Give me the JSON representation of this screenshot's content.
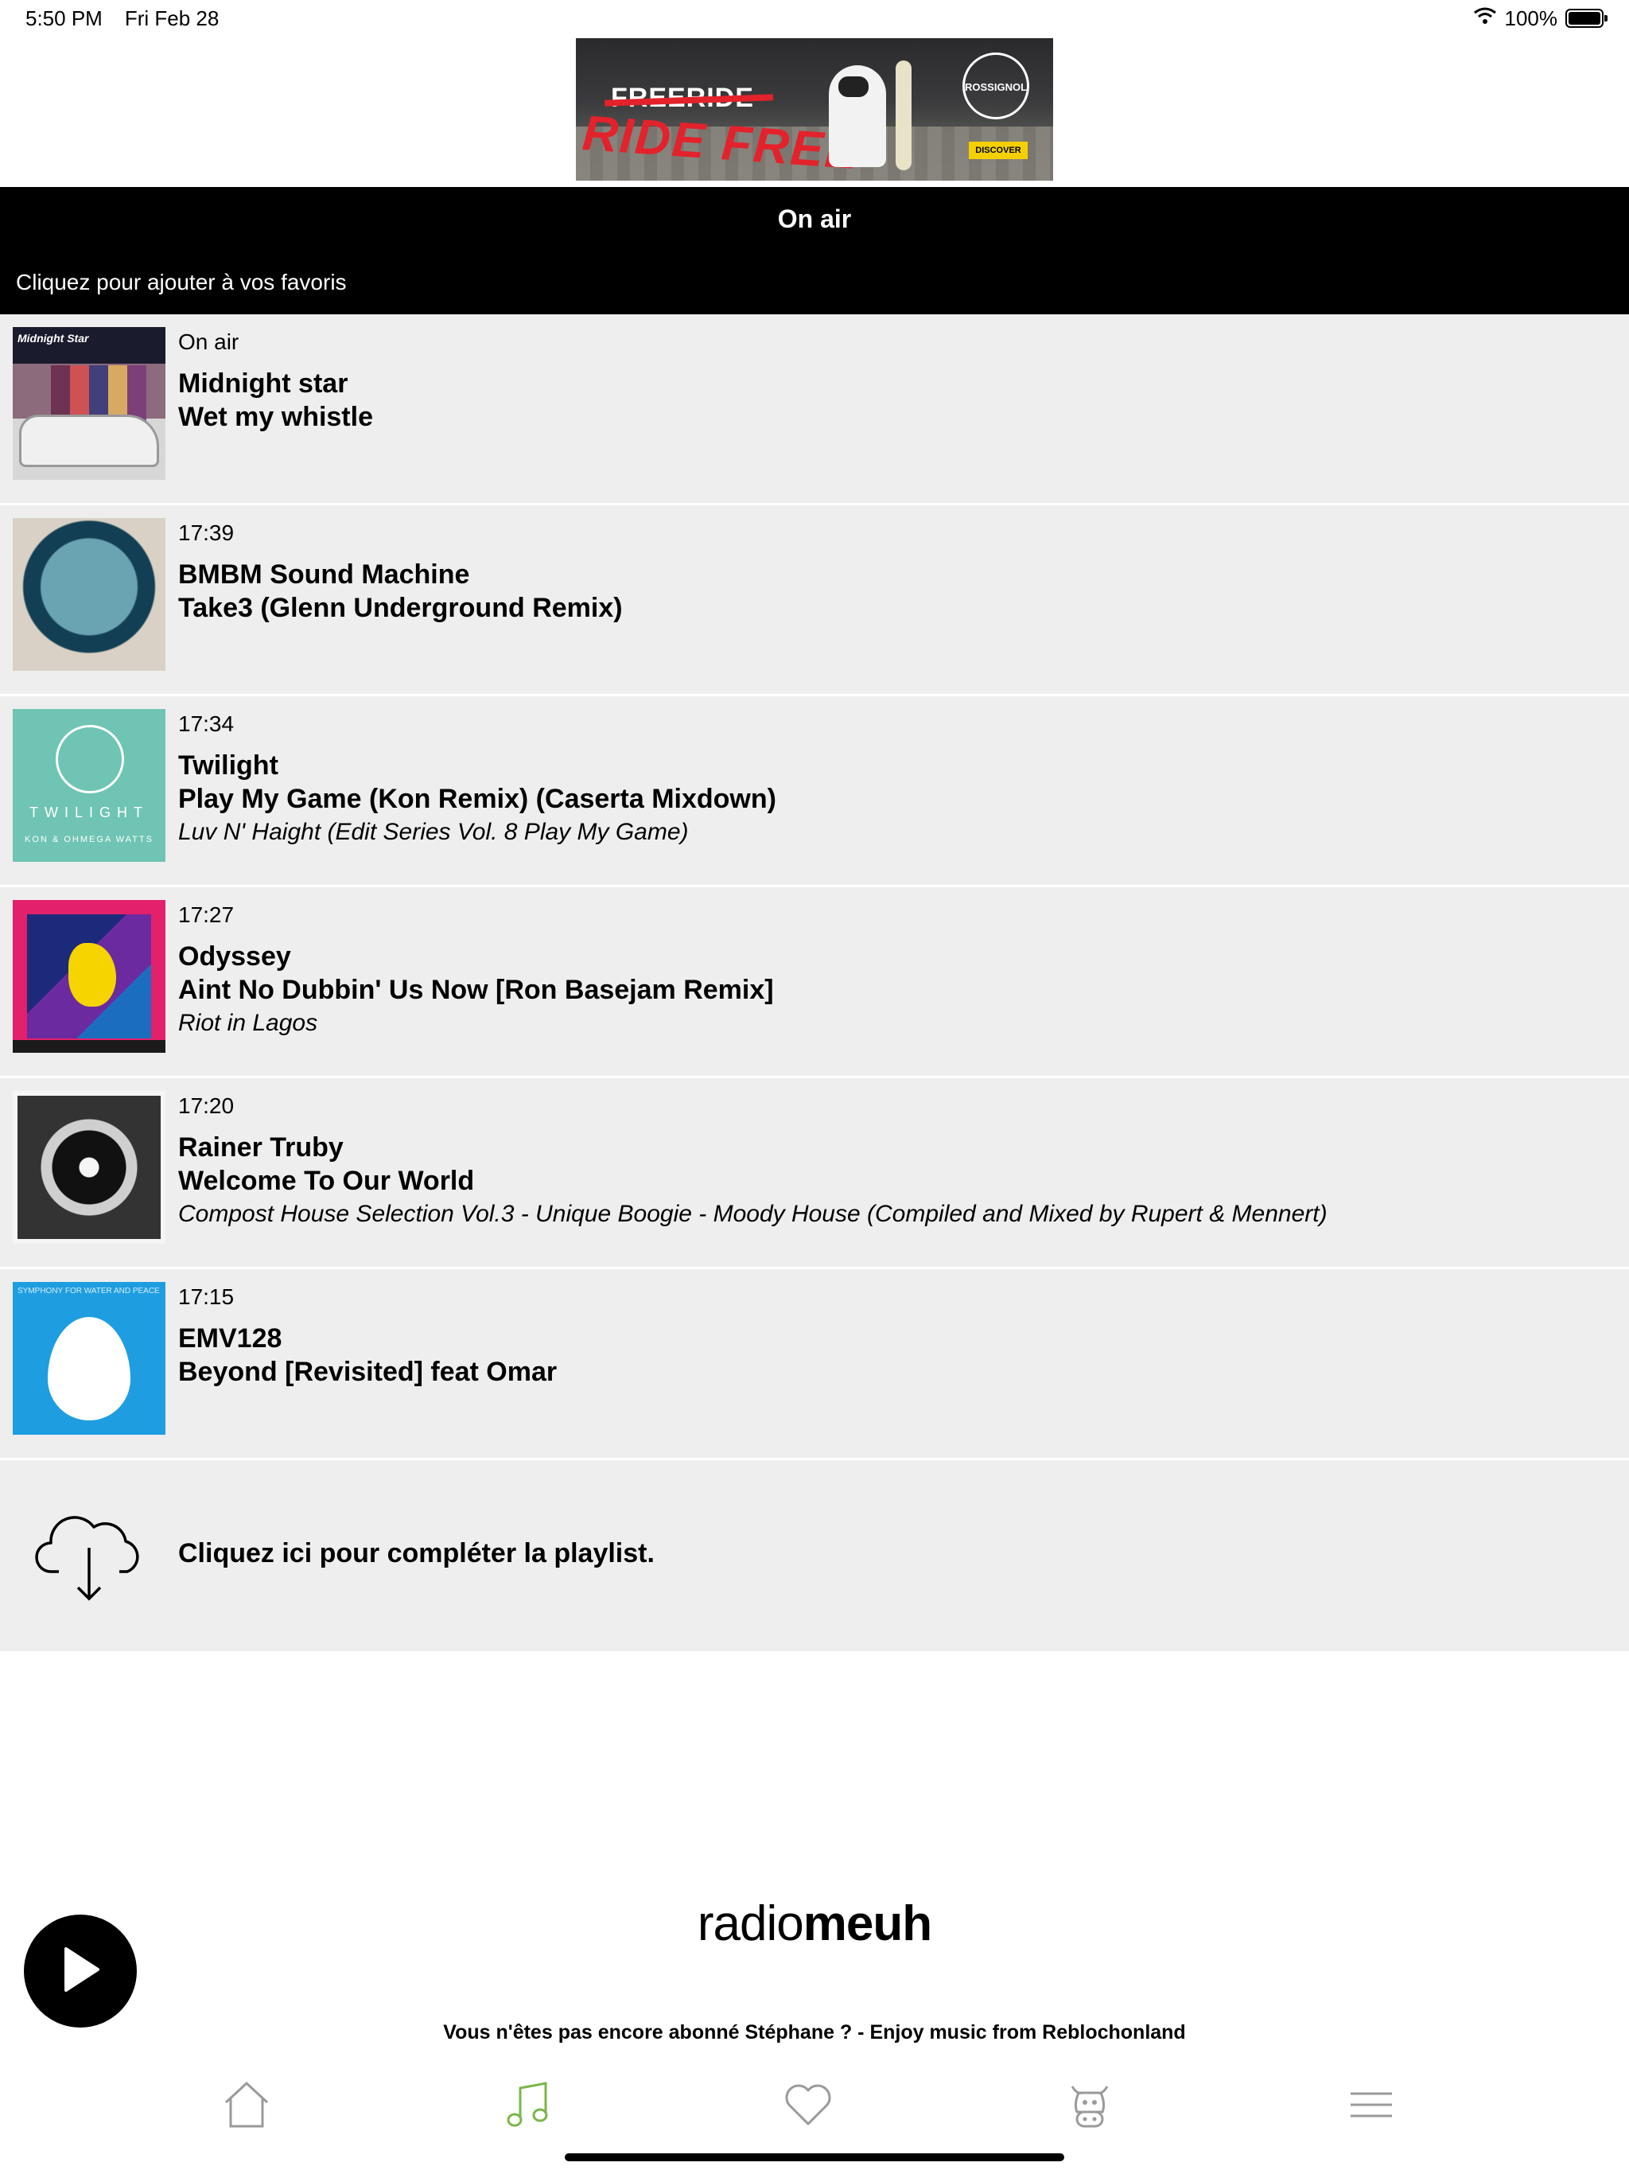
{
  "status_bar": {
    "time": "5:50 PM",
    "date": "Fri Feb 28",
    "battery": "100%",
    "battery_level": 1.0
  },
  "ad": {
    "strike_text": "FREERIDE",
    "headline": "RIDE FREE",
    "brand": "ROSSIGNOL",
    "cta": "DISCOVER"
  },
  "header": {
    "title": "On air",
    "subtitle": "Cliquez pour ajouter à vos favoris"
  },
  "tracks": [
    {
      "time": "On air",
      "artist": "Midnight star",
      "song": "Wet my whistle",
      "album": "",
      "cover_text": "Midnight Star"
    },
    {
      "time": "17:39",
      "artist": "BMBM Sound Machine",
      "song": "Take3 (Glenn Underground Remix)",
      "album": ""
    },
    {
      "time": "17:34",
      "artist": "Twilight",
      "song": "Play My Game (Kon Remix) (Caserta Mixdown)",
      "album": "Luv N' Haight (Edit Series Vol. 8 Play My Game)",
      "cover_title": "TWILIGHT",
      "cover_sub": "KON & OHMEGA WATTS"
    },
    {
      "time": "17:27",
      "artist": "Odyssey",
      "song": "Aint No Dubbin' Us Now [Ron Basejam Remix]",
      "album": "Riot in Lagos"
    },
    {
      "time": "17:20",
      "artist": "Rainer Truby",
      "song": "Welcome To Our World",
      "album": "Compost House Selection Vol.3 - Unique Boogie - Moody House (Compiled and Mixed by Rupert & Mennert)"
    },
    {
      "time": "17:15",
      "artist": "EMV128",
      "song": "Beyond [Revisited] feat Omar",
      "album": "",
      "cover_text": "SYMPHONY FOR WATER AND PEACE"
    }
  ],
  "load_more": {
    "label": "Cliquez ici pour compléter la playlist.",
    "icon": "cloud-download-icon"
  },
  "brand": {
    "part1": "radio",
    "part2": "meuh"
  },
  "promo": "Vous n'êtes pas encore abonné Stéphane ? - Enjoy music from Reblochonland",
  "tabs": [
    {
      "icon": "home-icon",
      "active": false
    },
    {
      "icon": "music-note-icon",
      "active": true
    },
    {
      "icon": "heart-icon",
      "active": false
    },
    {
      "icon": "cow-icon",
      "active": false
    },
    {
      "icon": "menu-icon",
      "active": false
    }
  ],
  "colors": {
    "header_bg": "#000000",
    "row_bg": "#eeeeee",
    "active_tab": "#7ab648",
    "inactive_tab": "#9a9a9a"
  }
}
